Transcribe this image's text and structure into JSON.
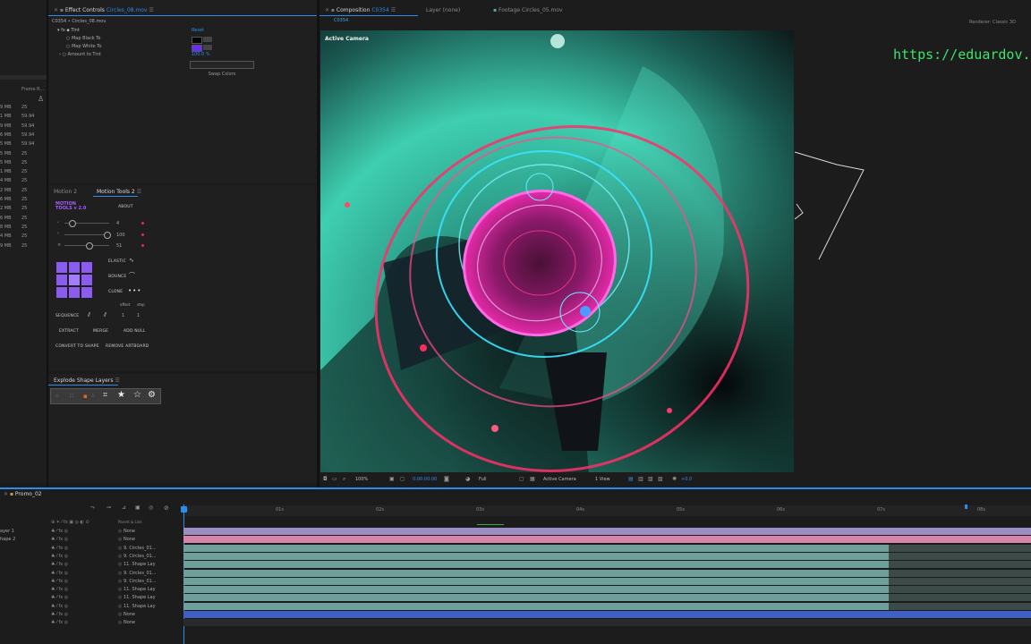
{
  "effect_controls": {
    "tab": "Effect Controls",
    "tab_file": "Circles_08.mov",
    "breadcrumb": "C0354 • Circles_08.mov",
    "fx_name": "Tint",
    "reset": "Reset",
    "params": [
      "Map Black To",
      "Map White To",
      "Amount to Tint"
    ],
    "amount_value": "100.0 %",
    "swap_button": "Swap Colors"
  },
  "project_list": {
    "header_col": "Frame R...",
    "sizes": [
      "9 MB",
      "1 MB",
      "9 MB",
      "6 MB",
      "5 MB",
      "5 MB",
      "5 MB",
      "1 MB",
      "4 MB",
      "2 MB",
      "6 MB",
      "2 MB",
      "6 MB",
      "8 MB",
      "4 MB",
      "9 MB"
    ],
    "rates": [
      "25",
      "59.94",
      "59.94",
      "59.94",
      "59.94",
      "25",
      "25",
      "25",
      "25",
      "25",
      "25",
      "25",
      "25",
      "25",
      "25",
      "25"
    ]
  },
  "motion_tools": {
    "tabs": [
      "Motion 2",
      "Motion Tools 2"
    ],
    "logo_line1": "MOTION",
    "logo_line2": "TOOLS v 2.0",
    "about": "ABOUT",
    "slider_values": [
      "4",
      "100",
      "51"
    ],
    "labels": {
      "elastic": "ELASTIC",
      "bounce": "BOUNCE",
      "clone": "CLONE",
      "sequence": "SEQUENCE",
      "offset": "offset",
      "step": "step",
      "extract": "EXTRACT",
      "merge": "MERGE",
      "add_null": "ADD NULL",
      "convert": "CONVERT TO SHAPE",
      "remove": "REMOVE ARTBOARD"
    },
    "seq_values": [
      "1",
      "1"
    ]
  },
  "explode_panel": {
    "title": "Explode Shape Layers"
  },
  "composition": {
    "tab": "Composition",
    "tab_name": "C0354",
    "layer_tab": "Layer (none)",
    "footage_tab": "Footage Circles_05.mov",
    "subtab": "C0354",
    "renderer": "Renderer:",
    "renderer_value": "Classic 3D",
    "view_label": "Active Camera",
    "url_overlay": "https://eduardov.c"
  },
  "viewer_toolbar": {
    "zoom": "100%",
    "timecode": "0:00:00:00",
    "resolution": "Full",
    "camera": "Active Camera",
    "views": "1 View",
    "exposure": "+0.0"
  },
  "timeline": {
    "tab": "Promo_02",
    "ruler": [
      "0s",
      "01s",
      "02s",
      "03s",
      "04s",
      "05s",
      "06s",
      "07s",
      "08s"
    ],
    "col_header": "Parent & Link",
    "layers": [
      {
        "name": "ayer 1",
        "parent": "None",
        "color": "#9a8fc0"
      },
      {
        "name": "hape 2",
        "parent": "None",
        "color": "#d784a8"
      },
      {
        "name": "",
        "parent": "9. Circles_01...",
        "color": "#6e9f9b"
      },
      {
        "name": "",
        "parent": "9. Circles_01...",
        "color": "#6e9f9b"
      },
      {
        "name": "",
        "parent": "11. Shape Lay",
        "color": "#6e9f9b"
      },
      {
        "name": "",
        "parent": "9. Circles_01...",
        "color": "#6e9f9b"
      },
      {
        "name": "",
        "parent": "9. Circles_01...",
        "color": "#6e9f9b"
      },
      {
        "name": "",
        "parent": "11. Shape Lay",
        "color": "#6e9f9b"
      },
      {
        "name": "",
        "parent": "11. Shape Lay",
        "color": "#6e9f9b"
      },
      {
        "name": "",
        "parent": "11. Shape Lay",
        "color": "#6e9f9b"
      },
      {
        "name": "",
        "parent": "None",
        "color": "#3e5fc4"
      },
      {
        "name": "",
        "parent": "None",
        "color": "#2a2a2a"
      }
    ]
  },
  "colors": {
    "accent": "#2d8ceb",
    "motion_purple": "#a45cff",
    "url_green": "#3ee36a"
  }
}
